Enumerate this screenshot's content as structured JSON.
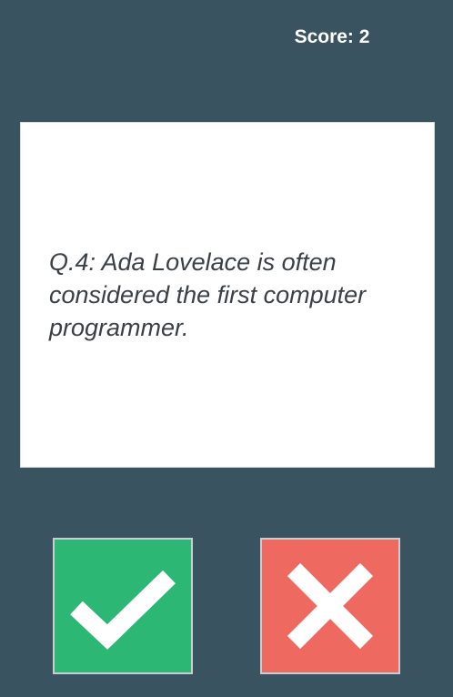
{
  "hud": {
    "score_label": "Score: 2"
  },
  "question": {
    "text": "Q.4: Ada Lovelace is often considered the first computer programmer."
  },
  "answers": {
    "true_icon": "checkmark-icon",
    "false_icon": "cross-icon"
  },
  "colors": {
    "background": "#3a5361",
    "card": "#ffffff",
    "true_button": "#2cb774",
    "false_button": "#ee6a61",
    "question_text": "#3b4046"
  }
}
